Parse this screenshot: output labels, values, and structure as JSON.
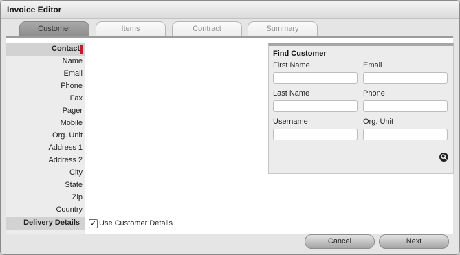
{
  "window": {
    "title": "Invoice Editor"
  },
  "tabs": [
    {
      "label": "Customer",
      "active": true
    },
    {
      "label": "Items",
      "active": false
    },
    {
      "label": "Contract",
      "active": false
    },
    {
      "label": "Summary",
      "active": false
    }
  ],
  "contact": {
    "section_label": "Contact",
    "required_marker_color": "#b6212b",
    "fields": [
      "Name",
      "Email",
      "Phone",
      "Fax",
      "Pager",
      "Mobile",
      "Org. Unit",
      "Address 1",
      "Address 2",
      "City",
      "State",
      "Zip",
      "Country"
    ]
  },
  "delivery": {
    "section_label": "Delivery Details",
    "checkbox_label": "Use Customer Details",
    "checked": true,
    "check_glyph": "✓"
  },
  "find_customer": {
    "title": "Find Customer",
    "fields": {
      "first_name": {
        "label": "First Name",
        "value": ""
      },
      "email": {
        "label": "Email",
        "value": ""
      },
      "last_name": {
        "label": "Last Name",
        "value": ""
      },
      "phone": {
        "label": "Phone",
        "value": ""
      },
      "username": {
        "label": "Username",
        "value": ""
      },
      "org_unit": {
        "label": "Org. Unit",
        "value": ""
      }
    },
    "search_icon": "magnifier-icon"
  },
  "footer": {
    "cancel_label": "Cancel",
    "next_label": "Next"
  }
}
